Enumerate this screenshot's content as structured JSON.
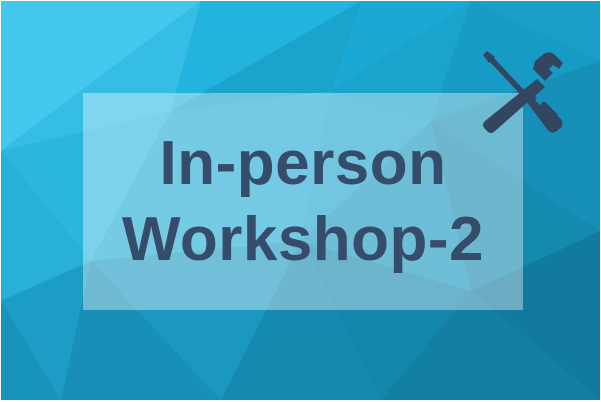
{
  "title": {
    "line1": "In-person",
    "line2": "Workshop-2"
  },
  "icon": "hammer-screwdriver-tools-icon",
  "colors": {
    "text": "#364c6b",
    "icon": "#33465f",
    "background_light": "#49c8ec",
    "background_mid": "#1aa6cf",
    "background_dark": "#127ea3",
    "panel_overlay": "rgba(255,255,255,0.38)"
  }
}
